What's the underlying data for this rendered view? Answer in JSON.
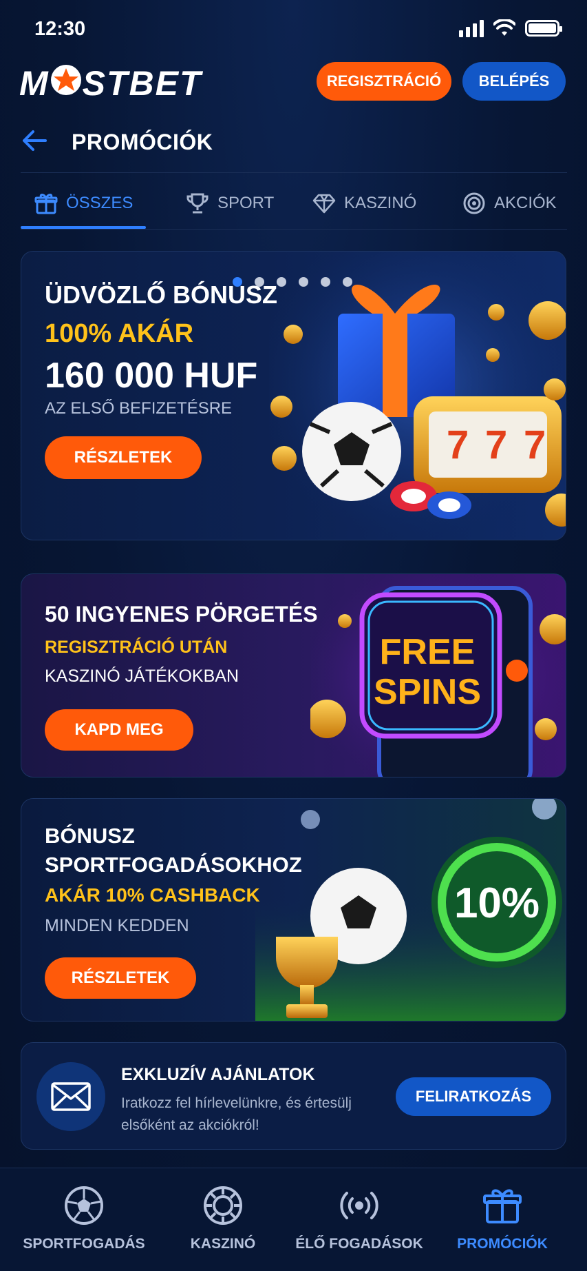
{
  "status_bar": {
    "time": "12:30",
    "icons": [
      "signal-icon",
      "wifi-icon",
      "battery-icon"
    ]
  },
  "header": {
    "logo_text_left": "M",
    "logo_text_right": "STBET",
    "register_label": "REGISZTRÁCIÓ",
    "login_label": "BELÉPÉS"
  },
  "page": {
    "title": "PROMÓCIÓK"
  },
  "tabs": [
    {
      "label": "ÖSSZES",
      "icon": "gift-icon",
      "active": true
    },
    {
      "label": "SPORT",
      "icon": "trophy-icon",
      "active": false
    },
    {
      "label": "KASZINÓ",
      "icon": "diamond-icon",
      "active": false
    },
    {
      "label": "AKCIÓK",
      "icon": "target-icon",
      "active": false
    }
  ],
  "promos": {
    "welcome": {
      "title": "ÜDVÖZLŐ BÓNUSZ",
      "accent": "100% AKÁR",
      "amount": "160 000 HUF",
      "subtitle": "AZ ELSŐ BEFIZETÉSRE",
      "button": "RÉSZLETEK",
      "slide_count": 6,
      "active_slide": 1
    },
    "spins": {
      "title": "50 INGYENES PÖRGETÉS",
      "accent": "REGISZTRÁCIÓ UTÁN",
      "subtitle": "KASZINÓ JÁTÉKOKBAN",
      "button": "KAPD MEG",
      "art_line1": "FREE",
      "art_line2": "SPINS"
    },
    "sport": {
      "title_line1": "BÓNUSZ",
      "title_line2": "SPORTFOGADÁSOKHOZ",
      "accent": "AKÁR 10% CASHBACK",
      "subtitle": "MINDEN KEDDEN",
      "button": "RÉSZLETEK",
      "badge": "10%"
    }
  },
  "newsletter": {
    "title": "EXKLUZÍV AJÁNLATOK",
    "text": "Iratkozz fel hírlevelünkre, és értesülj elsőként az akciókról!",
    "button": "FELIRATKOZÁS",
    "icon": "envelope-icon"
  },
  "bottom_nav": [
    {
      "label": "SPORTFOGADÁS",
      "icon": "soccer-ball-icon",
      "active": false
    },
    {
      "label": "KASZINÓ",
      "icon": "casino-chip-icon",
      "active": false
    },
    {
      "label": "ÉLŐ FOGADÁSOK",
      "icon": "live-broadcast-icon",
      "active": false
    },
    {
      "label": "PROMÓCIÓK",
      "icon": "gift-icon",
      "active": true
    }
  ],
  "colors": {
    "background": "#071634",
    "accent_orange": "#ff5a0a",
    "accent_blue": "#2f7fff",
    "accent_yellow": "#ffc21a"
  }
}
